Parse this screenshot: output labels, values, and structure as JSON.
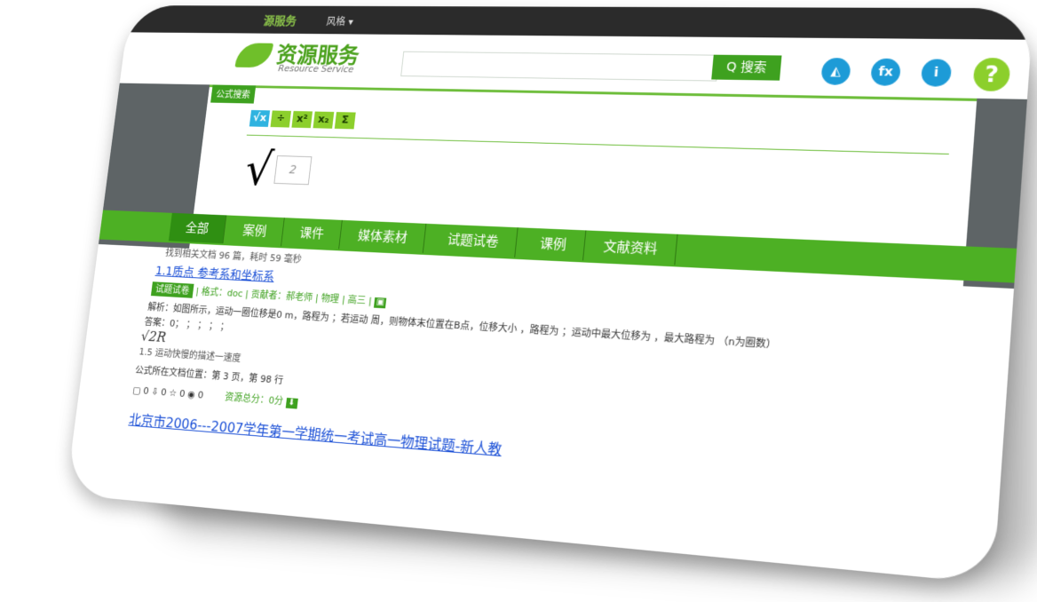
{
  "topbar": {
    "brand": "源服务",
    "style_menu": "风格 ▾"
  },
  "header": {
    "logo_title": "资源服务",
    "logo_subtitle": "Resource Service",
    "search_placeholder": "",
    "search_button": "Q 搜索",
    "icons": [
      "triangle-ruler-icon",
      "formula-icon",
      "info-icon",
      "help-icon"
    ]
  },
  "formula_panel": {
    "tag": "公式搜索",
    "tools": [
      "√x",
      "÷",
      "x²",
      "x₂",
      "Σ"
    ],
    "sqrt_symbol": "√",
    "input_value": "2"
  },
  "tabs": [
    {
      "label": "全部",
      "active": true
    },
    {
      "label": "案例"
    },
    {
      "label": "课件"
    },
    {
      "label": "媒体素材"
    },
    {
      "label": "试题试卷"
    },
    {
      "label": "课例"
    },
    {
      "label": "文献资料"
    }
  ],
  "results": {
    "summary": "找到相关文档 96 篇，耗时 59 毫秒",
    "item1": {
      "title": "1.1质点 参考系和坐标系",
      "badge": "试题试卷",
      "format": "格式：doc",
      "contributor": "贡献者：郝老师",
      "subject": "物理",
      "grade": "高三",
      "analysis": "解析：如图所示，运动一圈位移是0 m，路程为 ；若运动 周，则物体末位置在B点，位移大小 ，路程为 ；运动中最大位移为 ，最大路程为 （n为圈数）",
      "answer": "答案：0； ； ； ； ；",
      "formula_text": "√2R",
      "note": "1.5 运动快慢的描述一速度",
      "position": "公式所在文档位置：第 3 页，第 98 行",
      "stats": "▢ 0  ⇩ 0  ☆ 0  ◉ 0",
      "score": "资源总分：0分"
    },
    "item2": {
      "title": "北京市2006---2007学年第一学期统一考试高一物理试题-新人教"
    }
  }
}
